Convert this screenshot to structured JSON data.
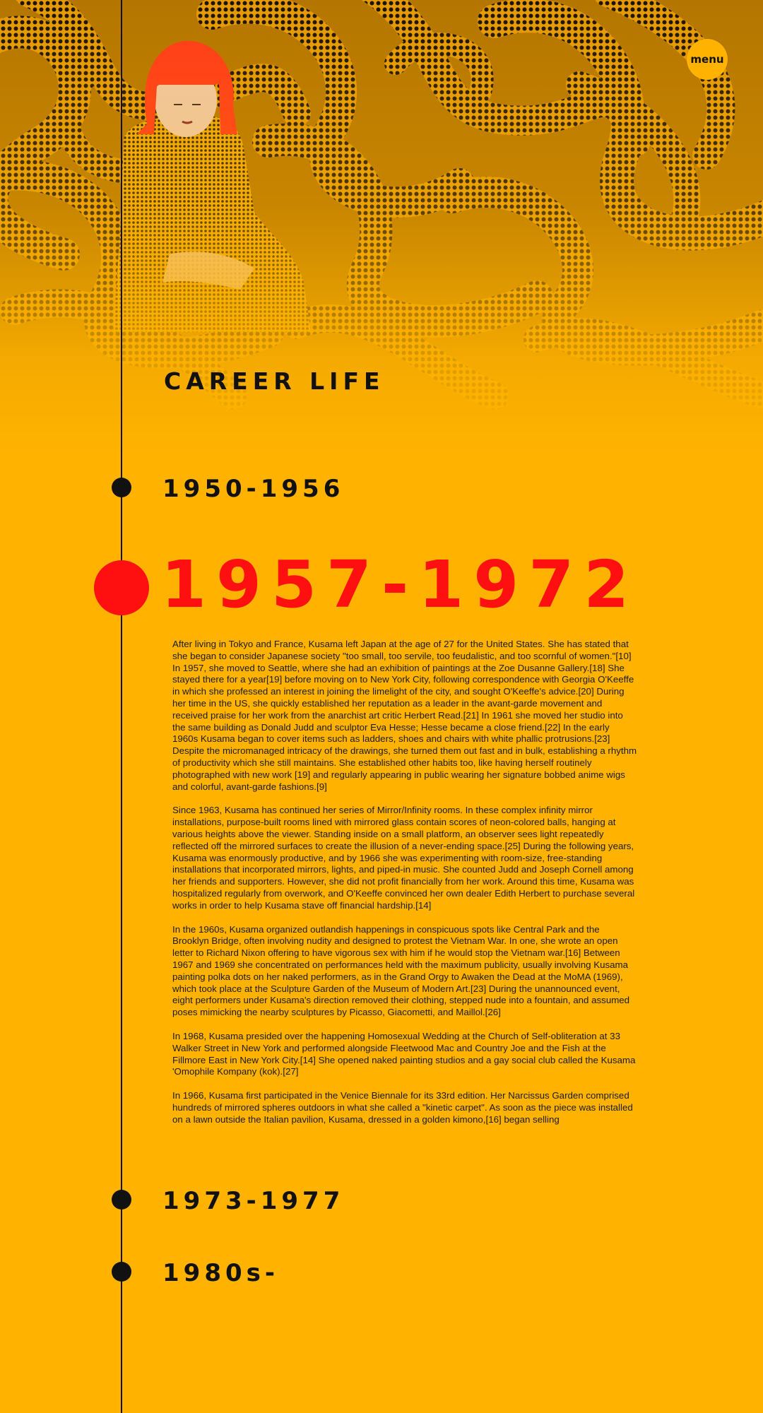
{
  "menu": {
    "label": "menu"
  },
  "page": {
    "section_title": "CAREER LIFE"
  },
  "timeline": {
    "eras": [
      {
        "label": "1950-1956",
        "active": false
      },
      {
        "label": "1957-1972",
        "active": true
      },
      {
        "label": "1973-1977",
        "active": false
      },
      {
        "label": "1980s-",
        "active": false
      }
    ]
  },
  "content": {
    "paragraphs": [
      "After living in Tokyo and France, Kusama left Japan at the age of 27 for the United States. She has stated that she began to consider Japanese society \"too small, too servile, too feudalistic, and too scornful of women.\"[10] In 1957, she moved to Seattle, where she had an exhibition of paintings at the Zoe Dusanne Gallery.[18] She stayed there for a year[19] before moving on to New York City, following correspondence with Georgia O'Keeffe in which she professed an interest in joining the limelight of the city, and sought O'Keeffe's advice.[20] During her time in the US, she quickly established her reputation as a leader in the avant-garde movement and received praise for her work from the anarchist art critic Herbert Read.[21] In 1961 she moved her studio into the same building as Donald Judd and sculptor Eva Hesse; Hesse became a close friend.[22] In the early 1960s Kusama began to cover items such as ladders, shoes and chairs with white phallic protrusions.[23] Despite the micromanaged intricacy of the drawings, she turned them out fast and in bulk, establishing a rhythm of productivity which she still maintains. She established other habits too, like having herself routinely photographed with new work [19] and regularly appearing in public wearing her signature bobbed anime wigs and colorful, avant-garde fashions.[9]",
      "Since 1963, Kusama has continued her series of Mirror/Infinity rooms. In these complex infinity mirror installations, purpose-built rooms lined with mirrored glass contain scores of neon-colored balls, hanging at various heights above the viewer. Standing inside on a small platform, an observer sees light repeatedly reflected off the mirrored surfaces to create the illusion of a never-ending space.[25] During the following years, Kusama was enormously productive, and by 1966 she was experimenting with room-size, free-standing installations that incorporated mirrors, lights, and piped-in music. She counted Judd and Joseph Cornell among her friends and supporters. However, she did not profit financially from her work. Around this time, Kusama was hospitalized regularly from overwork, and O'Keeffe convinced her own dealer Edith Herbert to purchase several works in order to help Kusama stave off financial hardship.[14]",
      "In the 1960s, Kusama organized outlandish happenings in conspicuous spots like Central Park and the Brooklyn Bridge, often involving nudity and designed to protest the Vietnam War. In one, she wrote an open letter to Richard Nixon offering to have vigorous sex with him if he would stop the Vietnam war.[16] Between 1967 and 1969 she concentrated on performances held with the maximum publicity, usually involving Kusama painting polka dots on her naked performers, as in the Grand Orgy to Awaken the Dead at the MoMA (1969), which took place at the Sculpture Garden of the Museum of Modern Art.[23] During the unannounced event, eight performers under Kusama's direction removed their clothing, stepped nude into a fountain, and assumed poses mimicking the nearby sculptures by Picasso, Giacometti, and Maillol.[26]",
      "In 1968, Kusama presided over the happening Homosexual Wedding at the Church of Self-obliteration at 33 Walker Street in New York and performed alongside Fleetwood Mac and Country Joe and the Fish at the Fillmore East in New York City.[14] She opened naked painting studios and a gay social club called the Kusama 'Omophile Kompany (kok).[27]",
      "In 1966, Kusama first participated in the Venice Biennale for its 33rd edition. Her Narcissus Garden comprised hundreds of mirrored spheres outdoors in what she called a \"kinetic carpet\". As soon as the piece was installed on a lawn outside the Italian pavilion, Kusama, dressed in a golden kimono,[16] began selling"
    ]
  }
}
